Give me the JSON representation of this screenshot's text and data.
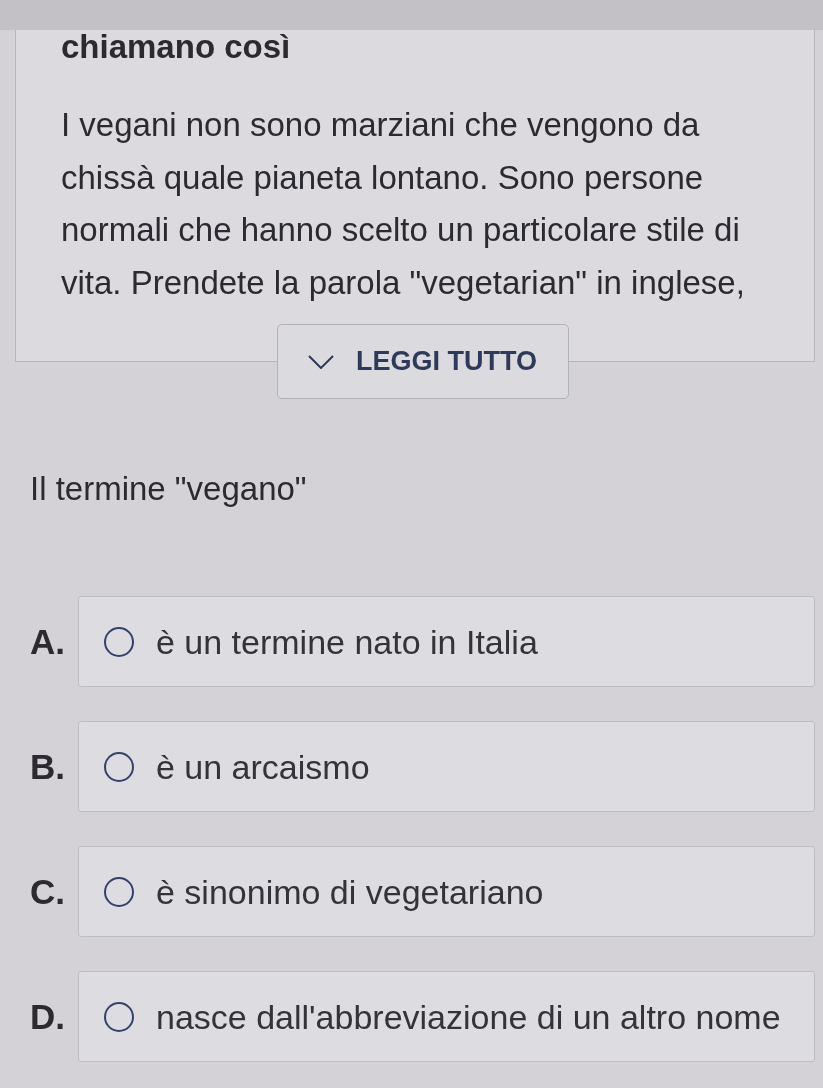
{
  "passage": {
    "heading": "chiamano così",
    "lines": [
      "I vegani non sono marziani che vengono da",
      "chissà quale pianeta lontano. Sono persone",
      "normali che hanno scelto un particolare stile di",
      "vita. Prendete la parola \"vegetarian\" in inglese,"
    ]
  },
  "read_more": {
    "label": "LEGGI TUTTO"
  },
  "question": "Il termine \"vegano\"",
  "options": [
    {
      "letter": "A.",
      "text": "è un termine nato in Italia",
      "selected": false
    },
    {
      "letter": "B.",
      "text": "è un arcaismo",
      "selected": false
    },
    {
      "letter": "C.",
      "text": "è sinonimo di vegetariano",
      "selected": false
    },
    {
      "letter": "D.",
      "text": "nasce dall'abbreviazione di un altro nome",
      "selected": false
    }
  ]
}
